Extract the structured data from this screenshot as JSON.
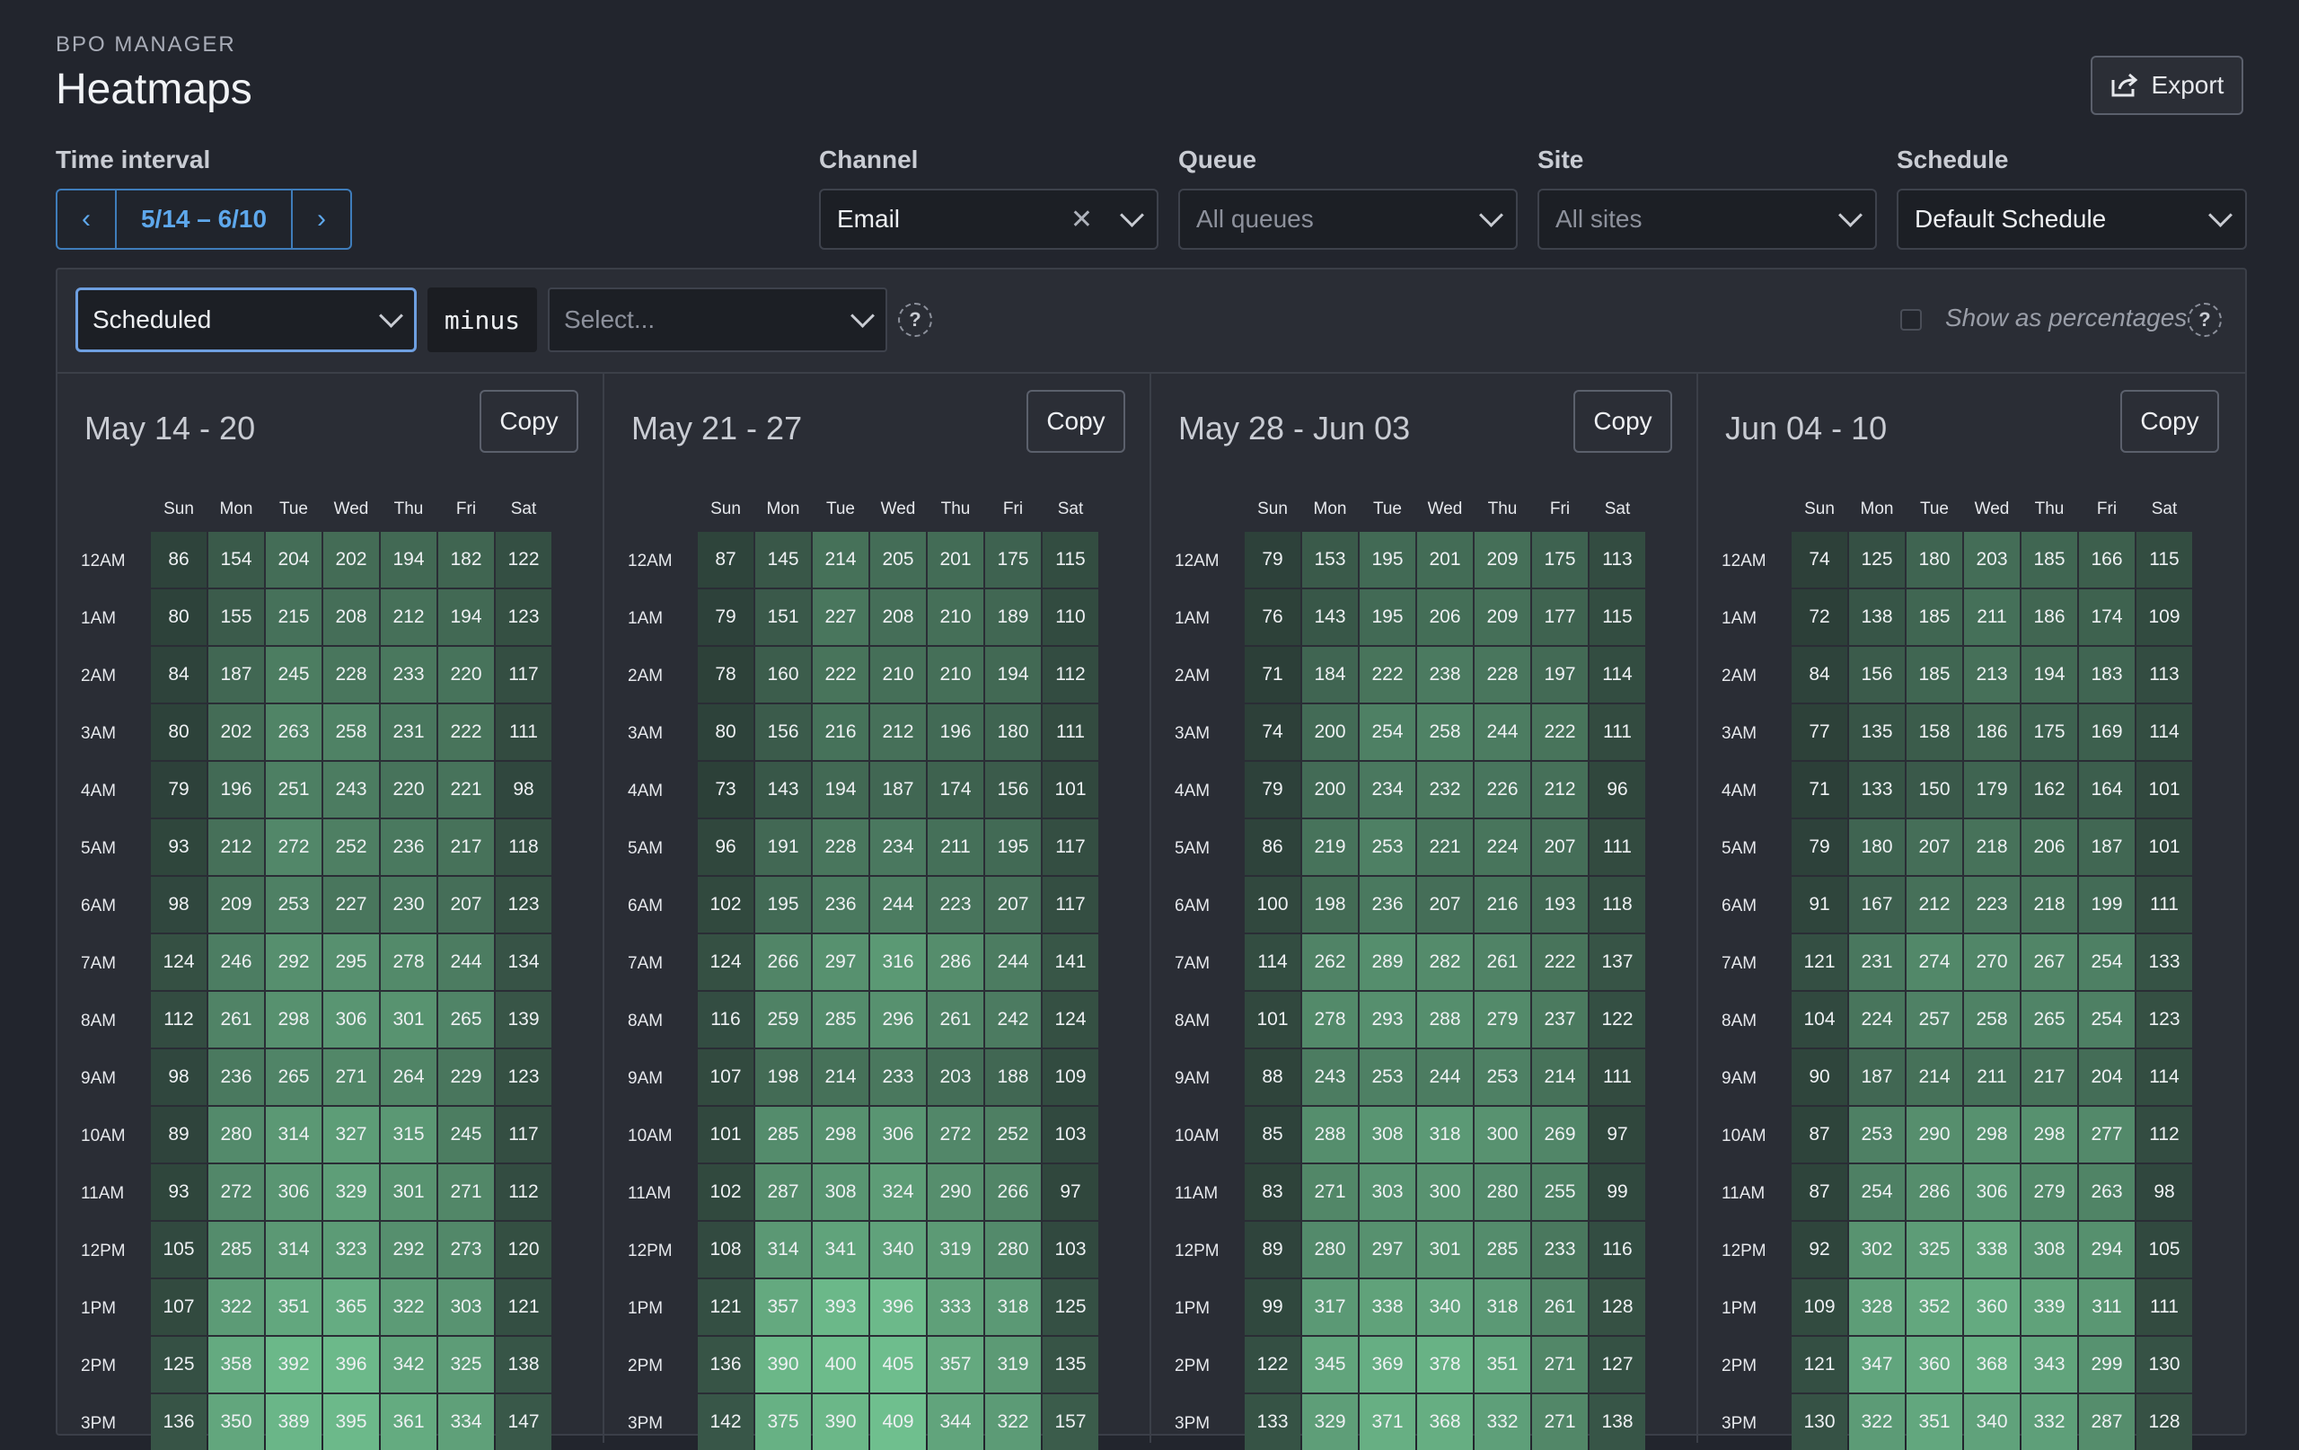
{
  "app_label": "BPO MANAGER",
  "page_title": "Heatmaps",
  "export_label": "Export",
  "filters": {
    "time_interval": {
      "label": "Time interval",
      "value": "5/14 – 6/10"
    },
    "channel": {
      "label": "Channel",
      "value": "Email"
    },
    "queue": {
      "label": "Queue",
      "placeholder": "All queues"
    },
    "site": {
      "label": "Site",
      "placeholder": "All sites"
    },
    "schedule": {
      "label": "Schedule",
      "value": "Default Schedule"
    }
  },
  "toolbar": {
    "metric": "Scheduled",
    "operator": "minus",
    "second_placeholder": "Select...",
    "show_percentages": "Show as percentages",
    "help": "?"
  },
  "copy_label": "Copy",
  "days": [
    "Sun",
    "Mon",
    "Tue",
    "Wed",
    "Thu",
    "Fri",
    "Sat"
  ],
  "hours": [
    "12AM",
    "1AM",
    "2AM",
    "3AM",
    "4AM",
    "5AM",
    "6AM",
    "7AM",
    "8AM",
    "9AM",
    "10AM",
    "11AM",
    "12PM",
    "1PM",
    "2PM",
    "3PM"
  ],
  "weeks": [
    {
      "title": "May 14 - 20",
      "rows": [
        [
          86,
          154,
          204,
          202,
          194,
          182,
          122
        ],
        [
          80,
          155,
          215,
          208,
          212,
          194,
          123
        ],
        [
          84,
          187,
          245,
          228,
          233,
          220,
          117
        ],
        [
          80,
          202,
          263,
          258,
          231,
          222,
          111
        ],
        [
          79,
          196,
          251,
          243,
          220,
          221,
          98
        ],
        [
          93,
          212,
          272,
          252,
          236,
          217,
          118
        ],
        [
          98,
          209,
          253,
          227,
          230,
          207,
          123
        ],
        [
          124,
          246,
          292,
          295,
          278,
          244,
          134
        ],
        [
          112,
          261,
          298,
          306,
          301,
          265,
          139
        ],
        [
          98,
          236,
          265,
          271,
          264,
          229,
          123
        ],
        [
          89,
          280,
          314,
          327,
          315,
          245,
          117
        ],
        [
          93,
          272,
          306,
          329,
          301,
          271,
          112
        ],
        [
          105,
          285,
          314,
          323,
          292,
          273,
          120
        ],
        [
          107,
          322,
          351,
          365,
          322,
          303,
          121
        ],
        [
          125,
          358,
          392,
          396,
          342,
          325,
          138
        ],
        [
          136,
          350,
          389,
          395,
          361,
          334,
          147
        ]
      ]
    },
    {
      "title": "May 21 - 27",
      "rows": [
        [
          87,
          145,
          214,
          205,
          201,
          175,
          115
        ],
        [
          79,
          151,
          227,
          208,
          210,
          189,
          110
        ],
        [
          78,
          160,
          222,
          210,
          210,
          194,
          112
        ],
        [
          80,
          156,
          216,
          212,
          196,
          180,
          111
        ],
        [
          73,
          143,
          194,
          187,
          174,
          156,
          101
        ],
        [
          96,
          191,
          228,
          234,
          211,
          195,
          117
        ],
        [
          102,
          195,
          236,
          244,
          223,
          207,
          117
        ],
        [
          124,
          266,
          297,
          316,
          286,
          244,
          141
        ],
        [
          116,
          259,
          285,
          296,
          261,
          242,
          124
        ],
        [
          107,
          198,
          214,
          233,
          203,
          188,
          109
        ],
        [
          101,
          285,
          298,
          306,
          272,
          252,
          103
        ],
        [
          102,
          287,
          308,
          324,
          290,
          266,
          97
        ],
        [
          108,
          314,
          341,
          340,
          319,
          280,
          103
        ],
        [
          121,
          357,
          393,
          396,
          333,
          318,
          125
        ],
        [
          136,
          390,
          400,
          405,
          357,
          319,
          135
        ],
        [
          142,
          375,
          390,
          409,
          344,
          322,
          157
        ]
      ]
    },
    {
      "title": "May 28 - Jun 03",
      "rows": [
        [
          79,
          153,
          195,
          201,
          209,
          175,
          113
        ],
        [
          76,
          143,
          195,
          206,
          209,
          177,
          115
        ],
        [
          71,
          184,
          222,
          238,
          228,
          197,
          114
        ],
        [
          74,
          200,
          254,
          258,
          244,
          222,
          111
        ],
        [
          79,
          200,
          234,
          232,
          226,
          212,
          96
        ],
        [
          86,
          219,
          253,
          221,
          224,
          207,
          111
        ],
        [
          100,
          198,
          236,
          207,
          216,
          193,
          118
        ],
        [
          114,
          262,
          289,
          282,
          261,
          222,
          137
        ],
        [
          101,
          278,
          293,
          288,
          279,
          237,
          122
        ],
        [
          88,
          243,
          253,
          244,
          253,
          214,
          111
        ],
        [
          85,
          288,
          308,
          318,
          300,
          269,
          97
        ],
        [
          83,
          271,
          303,
          300,
          280,
          255,
          99
        ],
        [
          89,
          280,
          297,
          301,
          285,
          233,
          116
        ],
        [
          99,
          317,
          338,
          340,
          318,
          261,
          128
        ],
        [
          122,
          345,
          369,
          378,
          351,
          271,
          127
        ],
        [
          133,
          329,
          371,
          368,
          332,
          271,
          138
        ]
      ]
    },
    {
      "title": "Jun 04 - 10",
      "rows": [
        [
          74,
          125,
          180,
          203,
          185,
          166,
          115
        ],
        [
          72,
          138,
          185,
          211,
          186,
          174,
          109
        ],
        [
          84,
          156,
          185,
          213,
          194,
          183,
          113
        ],
        [
          77,
          135,
          158,
          186,
          175,
          169,
          114
        ],
        [
          71,
          133,
          150,
          179,
          162,
          164,
          101
        ],
        [
          79,
          180,
          207,
          218,
          206,
          187,
          101
        ],
        [
          91,
          167,
          212,
          223,
          218,
          199,
          111
        ],
        [
          121,
          231,
          274,
          270,
          267,
          254,
          133
        ],
        [
          104,
          224,
          257,
          258,
          265,
          254,
          123
        ],
        [
          90,
          187,
          214,
          211,
          217,
          204,
          114
        ],
        [
          87,
          253,
          290,
          298,
          298,
          277,
          112
        ],
        [
          87,
          254,
          286,
          306,
          279,
          263,
          98
        ],
        [
          92,
          302,
          325,
          338,
          308,
          294,
          105
        ],
        [
          109,
          328,
          352,
          360,
          339,
          311,
          111
        ],
        [
          121,
          347,
          360,
          368,
          343,
          299,
          130
        ],
        [
          130,
          322,
          351,
          340,
          332,
          287,
          128
        ]
      ]
    }
  ],
  "colors": {
    "low": "#2c3f38",
    "high": "#6fbf8e"
  }
}
